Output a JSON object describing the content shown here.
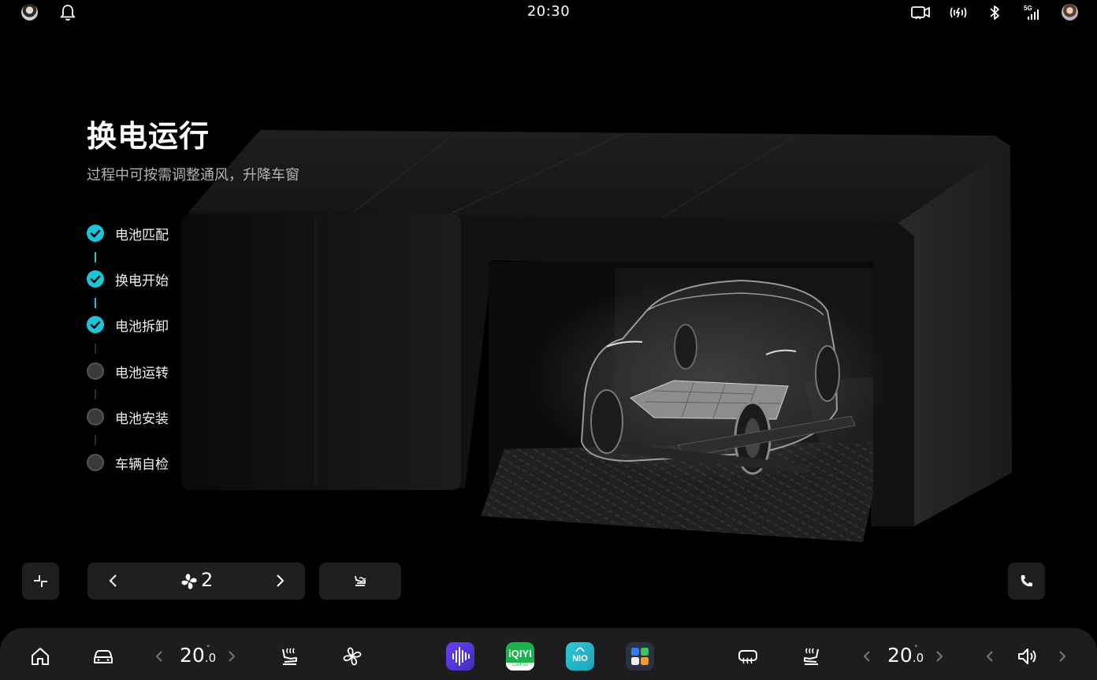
{
  "status_bar": {
    "time": "20:30",
    "icons": [
      "user-avatar",
      "bell-icon",
      "dashcam-icon",
      "wireless-charging-icon",
      "bluetooth-icon",
      "signal-5g-icon",
      "profile-avatar"
    ],
    "network": "5G"
  },
  "main": {
    "title": "换电运行",
    "subtitle": "过程中可按需调整通风，升降车窗",
    "steps": [
      {
        "label": "电池匹配",
        "done": true
      },
      {
        "label": "换电开始",
        "done": true
      },
      {
        "label": "电池拆卸",
        "done": true
      },
      {
        "label": "电池运转",
        "done": false
      },
      {
        "label": "电池安装",
        "done": false
      },
      {
        "label": "车辆自检",
        "done": false
      }
    ],
    "accent_color": "#1cc4d8"
  },
  "controls": {
    "fan_level": "2",
    "collapse_icon": "collapse-icon",
    "seat_ventilation_icon": "seat-ventilation-icon",
    "phone_icon": "phone-icon"
  },
  "dock": {
    "left_temp": "20",
    "left_temp_decimal": ".0",
    "right_temp": "20",
    "right_temp_decimal": ".0",
    "temp_unit": "°",
    "apps": [
      {
        "name": "voice-assistant-app",
        "color": "#5b3df0"
      },
      {
        "name": "iqiyi-app",
        "label": "iQIYI",
        "sublabel": "CarFun",
        "color": "#19b24b"
      },
      {
        "name": "nio-app",
        "label": "NIO",
        "color": "#24b7c9"
      },
      {
        "name": "app-grid",
        "color": "#2c3140"
      }
    ]
  }
}
